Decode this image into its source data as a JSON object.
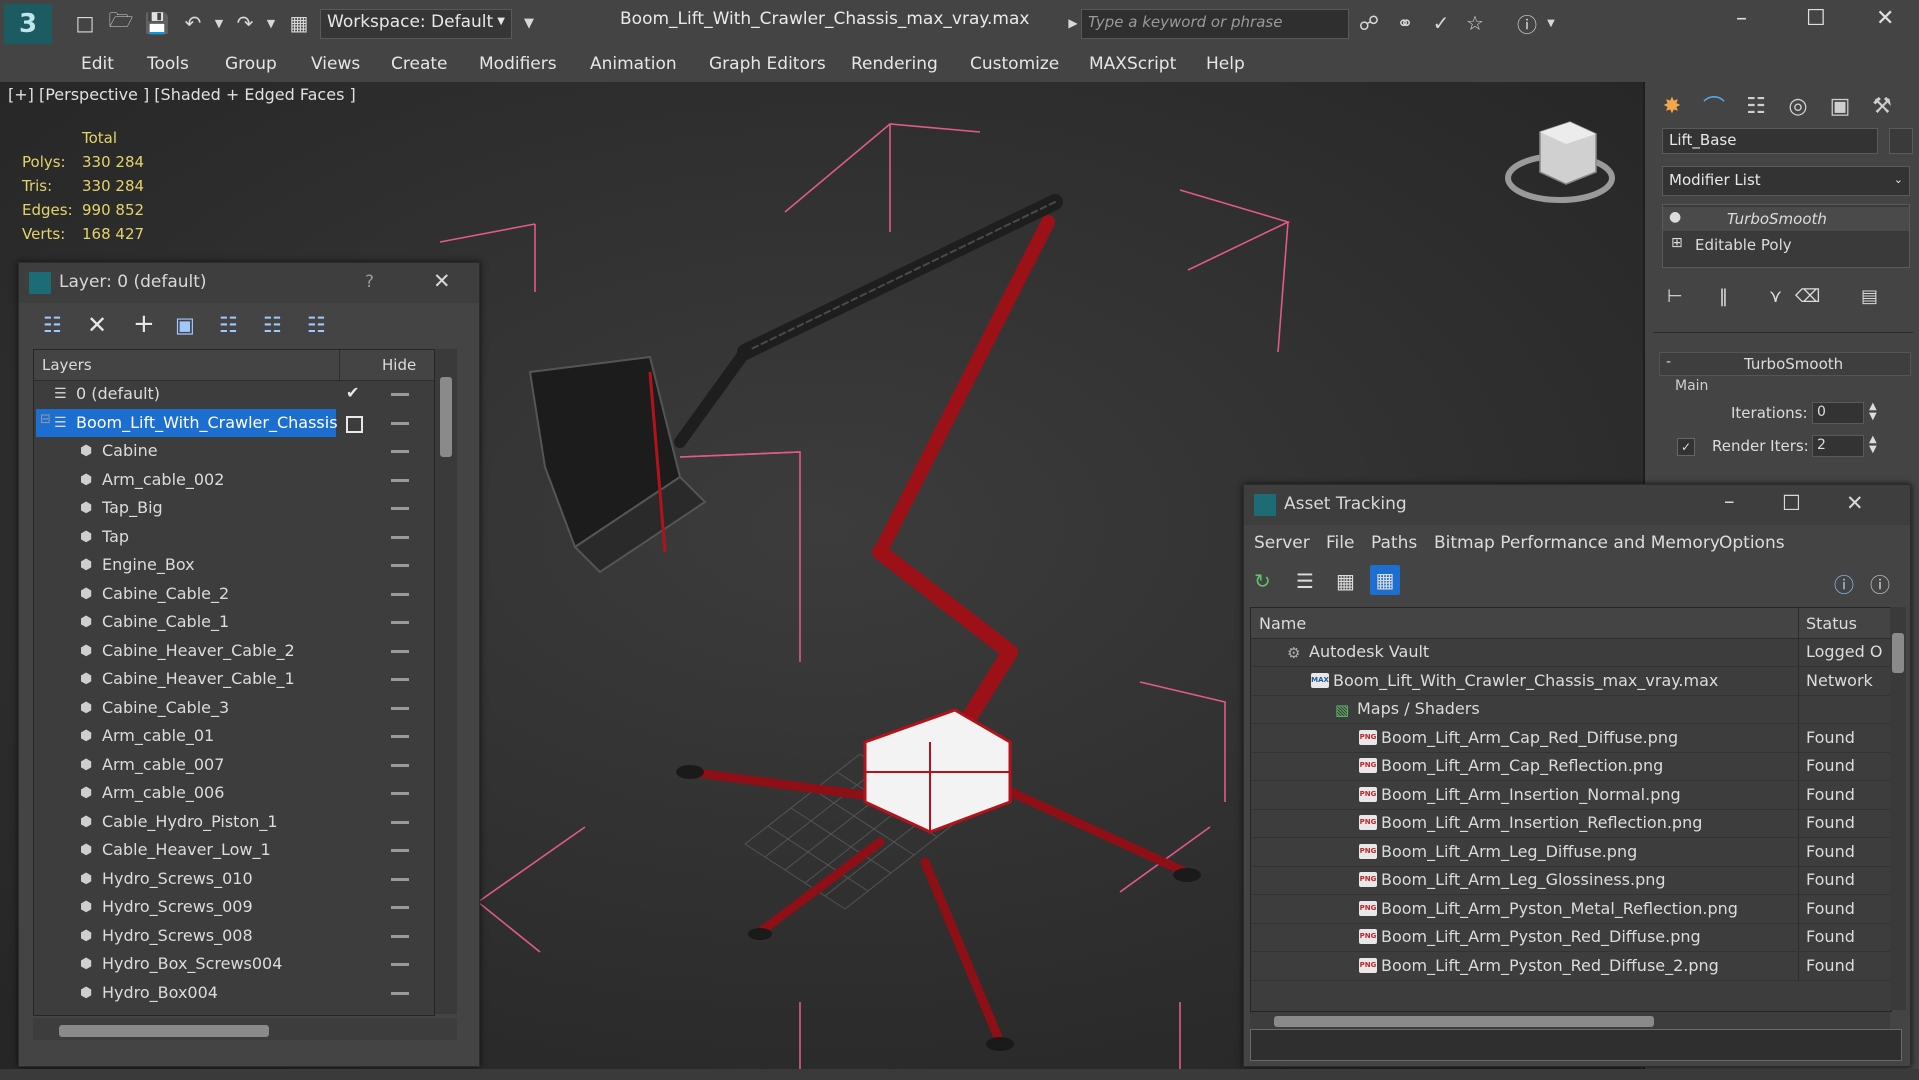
{
  "app": {
    "file_title": "Boom_Lift_With_Crawler_Chassis_max_vray.max",
    "workspace_label": "Workspace: Default",
    "search_placeholder": "Type a keyword or phrase"
  },
  "menu": [
    "Edit",
    "Tools",
    "Group",
    "Views",
    "Create",
    "Modifiers",
    "Animation",
    "Graph Editors",
    "Rendering",
    "Customize",
    "MAXScript",
    "Help"
  ],
  "viewport": {
    "label": "[+] [Perspective ] [Shaded + Edged Faces ]",
    "stats_header": "Total",
    "stats": [
      {
        "label": "Polys:",
        "value": "330 284"
      },
      {
        "label": "Tris:",
        "value": "330 284"
      },
      {
        "label": "Edges:",
        "value": "990 852"
      },
      {
        "label": "Verts:",
        "value": "168 427"
      }
    ]
  },
  "command_panel": {
    "object_name": "Lift_Base",
    "modifier_list_label": "Modifier List",
    "stack": [
      "TurboSmooth",
      "Editable Poly"
    ],
    "rollout_title": "TurboSmooth",
    "group_label": "Main",
    "iterations_label": "Iterations:",
    "iterations_value": "0",
    "render_iters_label": "Render Iters:",
    "render_iters_value": "2"
  },
  "layer_dialog": {
    "title": "Layer: 0 (default)",
    "help": "?",
    "col_layers": "Layers",
    "col_hide": "Hide",
    "rows": [
      {
        "name": "0 (default)",
        "type": "layer"
      },
      {
        "name": "Boom_Lift_With_Crawler_Chassis",
        "type": "layer-selected"
      },
      {
        "name": "Cabine",
        "type": "object"
      },
      {
        "name": "Arm_cable_002",
        "type": "object"
      },
      {
        "name": "Tap_Big",
        "type": "object"
      },
      {
        "name": "Tap",
        "type": "object"
      },
      {
        "name": "Engine_Box",
        "type": "object"
      },
      {
        "name": "Cabine_Cable_2",
        "type": "object"
      },
      {
        "name": "Cabine_Cable_1",
        "type": "object"
      },
      {
        "name": "Cabine_Heaver_Cable_2",
        "type": "object"
      },
      {
        "name": "Cabine_Heaver_Cable_1",
        "type": "object"
      },
      {
        "name": "Cabine_Cable_3",
        "type": "object"
      },
      {
        "name": "Arm_cable_01",
        "type": "object"
      },
      {
        "name": "Arm_cable_007",
        "type": "object"
      },
      {
        "name": "Arm_cable_006",
        "type": "object"
      },
      {
        "name": "Cable_Hydro_Piston_1",
        "type": "object"
      },
      {
        "name": "Cable_Heaver_Low_1",
        "type": "object"
      },
      {
        "name": "Hydro_Screws_010",
        "type": "object"
      },
      {
        "name": "Hydro_Screws_009",
        "type": "object"
      },
      {
        "name": "Hydro_Screws_008",
        "type": "object"
      },
      {
        "name": "Hydro_Box_Screws004",
        "type": "object"
      },
      {
        "name": "Hydro_Box004",
        "type": "object"
      }
    ]
  },
  "asset_dialog": {
    "title": "Asset Tracking",
    "menu": [
      "Server",
      "File",
      "Paths",
      "Bitmap Performance and Memory",
      "Options"
    ],
    "col_name": "Name",
    "col_status": "Status",
    "rows": [
      {
        "name": "Autodesk Vault",
        "status": "Logged O",
        "indent": 0,
        "icon": "vault"
      },
      {
        "name": "Boom_Lift_With_Crawler_Chassis_max_vray.max",
        "status": "Network",
        "indent": 1,
        "icon": "max"
      },
      {
        "name": "Maps / Shaders",
        "status": "",
        "indent": 2,
        "icon": "maps"
      },
      {
        "name": "Boom_Lift_Arm_Cap_Red_Diffuse.png",
        "status": "Found",
        "indent": 3,
        "icon": "png"
      },
      {
        "name": "Boom_Lift_Arm_Cap_Reflection.png",
        "status": "Found",
        "indent": 3,
        "icon": "png"
      },
      {
        "name": "Boom_Lift_Arm_Insertion_Normal.png",
        "status": "Found",
        "indent": 3,
        "icon": "png"
      },
      {
        "name": "Boom_Lift_Arm_Insertion_Reflection.png",
        "status": "Found",
        "indent": 3,
        "icon": "png"
      },
      {
        "name": "Boom_Lift_Arm_Leg_Diffuse.png",
        "status": "Found",
        "indent": 3,
        "icon": "png"
      },
      {
        "name": "Boom_Lift_Arm_Leg_Glossiness.png",
        "status": "Found",
        "indent": 3,
        "icon": "png"
      },
      {
        "name": "Boom_Lift_Arm_Pyston_Metal_Reflection.png",
        "status": "Found",
        "indent": 3,
        "icon": "png"
      },
      {
        "name": "Boom_Lift_Arm_Pyston_Red_Diffuse.png",
        "status": "Found",
        "indent": 3,
        "icon": "png"
      },
      {
        "name": "Boom_Lift_Arm_Pyston_Red_Diffuse_2.png",
        "status": "Found",
        "indent": 3,
        "icon": "png"
      }
    ]
  },
  "colors": {
    "selection_blue": "#1c6fd1",
    "stats_yellow": "#e4d36a",
    "model_red": "#b3121a",
    "bbox_pink": "#e05a8a"
  }
}
